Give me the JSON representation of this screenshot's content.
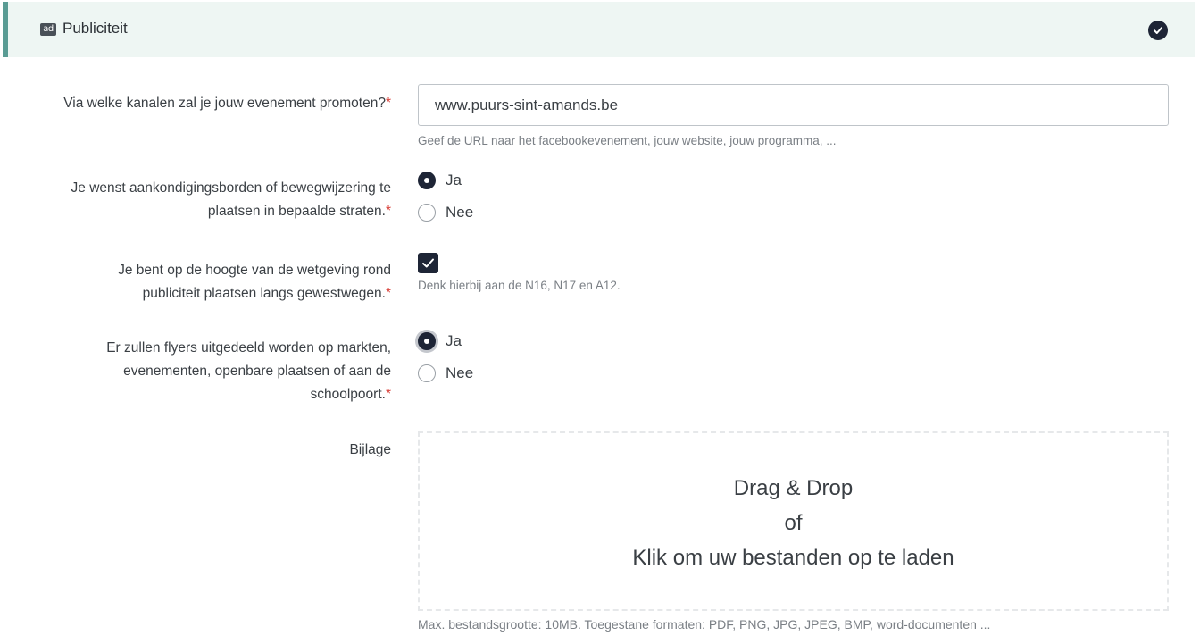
{
  "section": {
    "icon": "ad-icon",
    "icon_text": "ad",
    "title": "Publiciteit",
    "status_icon": "check-circle-icon"
  },
  "fields": {
    "channels": {
      "label": "Via welke kanalen zal je jouw evenement promoten?",
      "required": "*",
      "value": "www.puurs-sint-amands.be",
      "hint": "Geef de URL naar het facebookevenement, jouw website, jouw programma, ..."
    },
    "signs": {
      "label_line1": "Je wenst aankondigingsborden of bewegwijzering te",
      "label_line2": "plaatsen in bepaalde straten.",
      "required": "*",
      "options": [
        "Ja",
        "Nee"
      ],
      "selected": "Ja"
    },
    "legislation": {
      "label_line1": "Je bent op de hoogte van de wetgeving rond",
      "label_line2": "publiciteit plaatsen langs gewestwegen.",
      "required": "*",
      "checked": true,
      "hint": "Denk hierbij aan de N16, N17 en A12."
    },
    "flyers": {
      "label_line1": "Er zullen flyers uitgedeeld worden op markten,",
      "label_line2": "evenementen, openbare plaatsen of aan de",
      "label_line3": "schoolpoort.",
      "required": "*",
      "options": [
        "Ja",
        "Nee"
      ],
      "selected": "Ja"
    },
    "attachment": {
      "label": "Bijlage",
      "dropzone_line1": "Drag & Drop",
      "dropzone_line2": "of",
      "dropzone_line3": "Klik om uw bestanden op te laden",
      "hint": "Max. bestandsgrootte: 10MB. Toegestane formaten: PDF, PNG, JPG, JPEG, BMP, word-documenten ..."
    }
  },
  "colors": {
    "accent": "#1e2536",
    "header_bg": "#eef6f3",
    "header_border": "#5a9c94",
    "required": "#d9413a"
  }
}
